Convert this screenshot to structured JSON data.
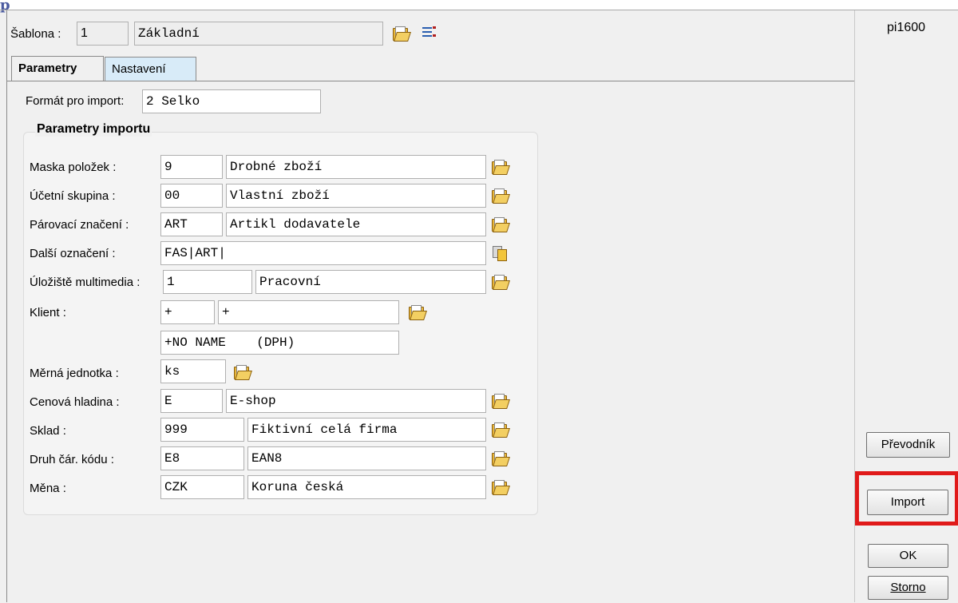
{
  "window": {
    "title_fragment": "p",
    "form_code": "pi1600"
  },
  "header": {
    "sablona_label": "Šablona :",
    "sablona_code": "1",
    "sablona_name": "Základní"
  },
  "tabs": [
    {
      "label": "Parametry",
      "active": true
    },
    {
      "label": "Nastavení",
      "active": false
    }
  ],
  "format": {
    "label": "Formát pro import:",
    "value": "2 Selko"
  },
  "group": {
    "title": "Parametry importu"
  },
  "rows": {
    "maska": {
      "label": "Maska položek :",
      "code": "9",
      "name": "Drobné zboží"
    },
    "ucetni": {
      "label": "Účetní skupina :",
      "code": "00",
      "name": "Vlastní zboží"
    },
    "parovaci": {
      "label": "Párovací značení :",
      "code": "ART",
      "name": "Artikl dodavatele"
    },
    "dalsi": {
      "label": "Další označení :",
      "value": "FAS|ART|"
    },
    "uloziste": {
      "label": "Úložiště multimedia :",
      "code": "1",
      "name": "Pracovní"
    },
    "klient": {
      "label": "Klient :",
      "code": "+",
      "name": "+",
      "extra": "+NO NAME    (DPH)"
    },
    "mj": {
      "label": "Měrná jednotka :",
      "code": "ks"
    },
    "cenova": {
      "label": "Cenová hladina :",
      "code": "E",
      "name": "E-shop"
    },
    "sklad": {
      "label": "Sklad :",
      "code": "999",
      "name": "Fiktivní celá firma"
    },
    "druh": {
      "label": "Druh čár. kódu :",
      "code": "E8",
      "name": "EAN8"
    },
    "mena": {
      "label": "Měna :",
      "code": "CZK",
      "name": "Koruna česká"
    }
  },
  "buttons": {
    "prevodnik": "Převodník",
    "import": "Import",
    "ok": "OK",
    "storno": "Storno"
  },
  "colors": {
    "highlight": "#e01a1a",
    "inactive_tab": "#d8ebf8"
  },
  "icons": {
    "browse": "folder-open-icon",
    "list": "list-icon",
    "copy": "copy-icon"
  }
}
